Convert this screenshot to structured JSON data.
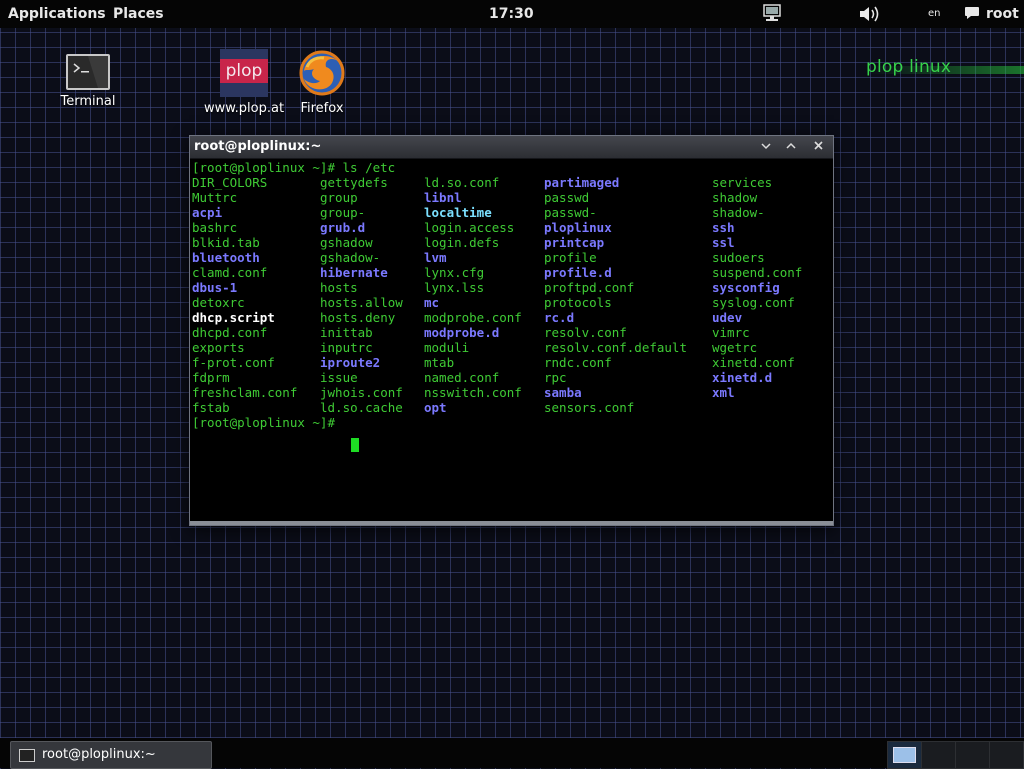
{
  "topbar": {
    "applications": "Applications",
    "places": "Places",
    "clock": "17:30",
    "lang": "en",
    "user": "root"
  },
  "desktop": {
    "icons": [
      {
        "label": "Terminal",
        "icon": "terminal-icon"
      },
      {
        "label": "www.plop.at",
        "icon": "plop-icon",
        "icon_text": "plop"
      },
      {
        "label": "Firefox",
        "icon": "firefox-icon"
      }
    ],
    "brand": "plop linux"
  },
  "window": {
    "title": "root@ploplinux:~",
    "command_line": "[root@ploplinux ~]# ls /etc",
    "prompt_line": "[root@ploplinux ~]# ",
    "listing": [
      [
        {
          "name": "DIR_COLORS",
          "kind": "file"
        },
        {
          "name": "Muttrc",
          "kind": "file"
        },
        {
          "name": "acpi",
          "kind": "dir"
        },
        {
          "name": "bashrc",
          "kind": "file"
        },
        {
          "name": "blkid.tab",
          "kind": "file"
        },
        {
          "name": "bluetooth",
          "kind": "dir"
        },
        {
          "name": "clamd.conf",
          "kind": "file"
        },
        {
          "name": "dbus-1",
          "kind": "dir"
        },
        {
          "name": "detoxrc",
          "kind": "file"
        },
        {
          "name": "dhcp.script",
          "kind": "exec"
        },
        {
          "name": "dhcpd.conf",
          "kind": "file"
        },
        {
          "name": "exports",
          "kind": "file"
        },
        {
          "name": "f-prot.conf",
          "kind": "file"
        },
        {
          "name": "fdprm",
          "kind": "file"
        },
        {
          "name": "freshclam.conf",
          "kind": "file"
        },
        {
          "name": "fstab",
          "kind": "file"
        }
      ],
      [
        {
          "name": "gettydefs",
          "kind": "file"
        },
        {
          "name": "group",
          "kind": "file"
        },
        {
          "name": "group-",
          "kind": "file"
        },
        {
          "name": "grub.d",
          "kind": "dir"
        },
        {
          "name": "gshadow",
          "kind": "file"
        },
        {
          "name": "gshadow-",
          "kind": "file"
        },
        {
          "name": "hibernate",
          "kind": "dir"
        },
        {
          "name": "hosts",
          "kind": "file"
        },
        {
          "name": "hosts.allow",
          "kind": "file"
        },
        {
          "name": "hosts.deny",
          "kind": "file"
        },
        {
          "name": "inittab",
          "kind": "file"
        },
        {
          "name": "inputrc",
          "kind": "file"
        },
        {
          "name": "iproute2",
          "kind": "dir"
        },
        {
          "name": "issue",
          "kind": "file"
        },
        {
          "name": "jwhois.conf",
          "kind": "file"
        },
        {
          "name": "ld.so.cache",
          "kind": "file"
        }
      ],
      [
        {
          "name": "ld.so.conf",
          "kind": "file"
        },
        {
          "name": "libnl",
          "kind": "dir"
        },
        {
          "name": "localtime",
          "kind": "link"
        },
        {
          "name": "login.access",
          "kind": "file"
        },
        {
          "name": "login.defs",
          "kind": "file"
        },
        {
          "name": "lvm",
          "kind": "dir"
        },
        {
          "name": "lynx.cfg",
          "kind": "file"
        },
        {
          "name": "lynx.lss",
          "kind": "file"
        },
        {
          "name": "mc",
          "kind": "dir"
        },
        {
          "name": "modprobe.conf",
          "kind": "file"
        },
        {
          "name": "modprobe.d",
          "kind": "dir"
        },
        {
          "name": "moduli",
          "kind": "file"
        },
        {
          "name": "mtab",
          "kind": "file"
        },
        {
          "name": "named.conf",
          "kind": "file"
        },
        {
          "name": "nsswitch.conf",
          "kind": "file"
        },
        {
          "name": "opt",
          "kind": "dir"
        }
      ],
      [
        {
          "name": "partimaged",
          "kind": "dir"
        },
        {
          "name": "passwd",
          "kind": "file"
        },
        {
          "name": "passwd-",
          "kind": "file"
        },
        {
          "name": "ploplinux",
          "kind": "dir"
        },
        {
          "name": "printcap",
          "kind": "dir"
        },
        {
          "name": "profile",
          "kind": "file"
        },
        {
          "name": "profile.d",
          "kind": "dir"
        },
        {
          "name": "proftpd.conf",
          "kind": "file"
        },
        {
          "name": "protocols",
          "kind": "file"
        },
        {
          "name": "rc.d",
          "kind": "dir"
        },
        {
          "name": "resolv.conf",
          "kind": "file"
        },
        {
          "name": "resolv.conf.default",
          "kind": "file"
        },
        {
          "name": "rndc.conf",
          "kind": "file"
        },
        {
          "name": "rpc",
          "kind": "file"
        },
        {
          "name": "samba",
          "kind": "dir"
        },
        {
          "name": "sensors.conf",
          "kind": "file"
        }
      ],
      [
        {
          "name": "services",
          "kind": "file"
        },
        {
          "name": "shadow",
          "kind": "file"
        },
        {
          "name": "shadow-",
          "kind": "file"
        },
        {
          "name": "ssh",
          "kind": "dir"
        },
        {
          "name": "ssl",
          "kind": "dir"
        },
        {
          "name": "sudoers",
          "kind": "file"
        },
        {
          "name": "suspend.conf",
          "kind": "file"
        },
        {
          "name": "sysconfig",
          "kind": "dir"
        },
        {
          "name": "syslog.conf",
          "kind": "file"
        },
        {
          "name": "udev",
          "kind": "dir"
        },
        {
          "name": "vimrc",
          "kind": "file"
        },
        {
          "name": "wgetrc",
          "kind": "file"
        },
        {
          "name": "xinetd.conf",
          "kind": "file"
        },
        {
          "name": "xinetd.d",
          "kind": "dir"
        },
        {
          "name": "xml",
          "kind": "dir"
        }
      ]
    ]
  },
  "taskbar": {
    "task_label": "root@ploplinux:~"
  },
  "colors": {
    "file": "#3fcb35",
    "dir": "#7b79ff",
    "link": "#7be0ff",
    "exec": "#ffffff",
    "cursor": "#1edc24"
  }
}
